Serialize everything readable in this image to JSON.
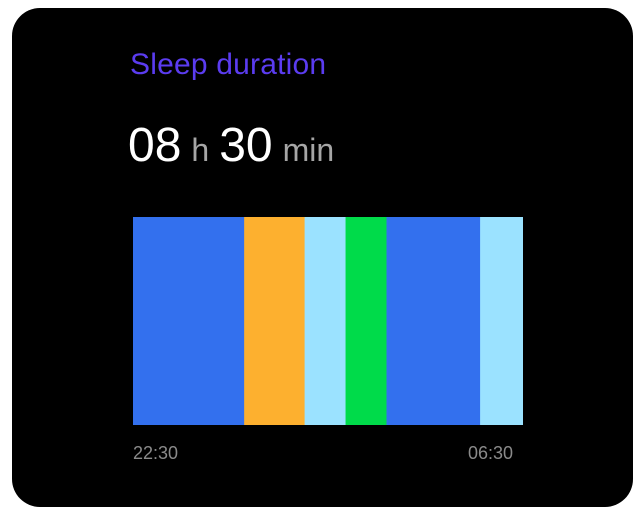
{
  "card": {
    "title": "Sleep duration",
    "hours": "08",
    "hours_unit": "h",
    "minutes": "30",
    "minutes_unit": "min"
  },
  "chart_data": {
    "type": "bar",
    "x_start_label": "22:30",
    "x_end_label": "06:30",
    "segments": [
      {
        "start": 0.0,
        "end": 0.285,
        "color": "#3370EE"
      },
      {
        "start": 0.285,
        "end": 0.44,
        "color": "#FDB02F"
      },
      {
        "start": 0.44,
        "end": 0.545,
        "color": "#9BE2FF"
      },
      {
        "start": 0.545,
        "end": 0.65,
        "color": "#00DB4A"
      },
      {
        "start": 0.65,
        "end": 0.89,
        "color": "#3370EE"
      },
      {
        "start": 0.89,
        "end": 1.0,
        "color": "#9BE2FF"
      }
    ]
  }
}
